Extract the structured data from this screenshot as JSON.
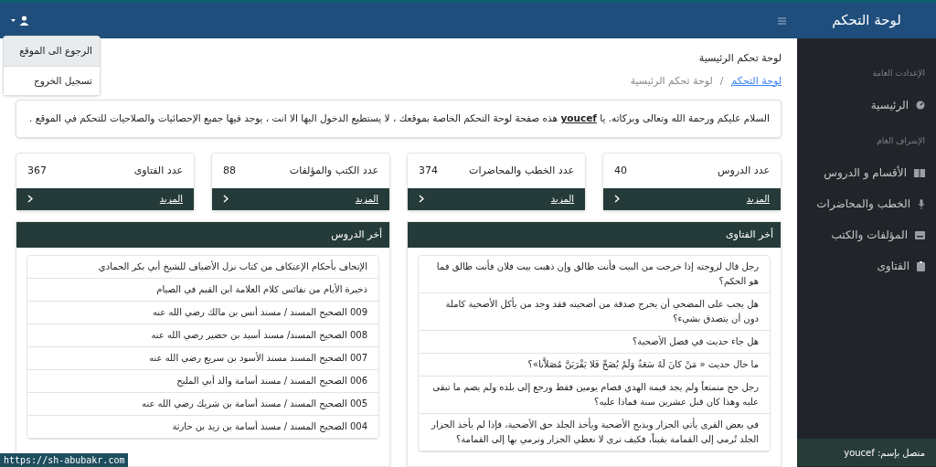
{
  "brand": "لوحة التحكم",
  "user_menu": {
    "items": [
      {
        "label": "الرجوع الى الموقع",
        "selected": true
      },
      {
        "label": "تسجيل الخروج",
        "selected": false
      }
    ]
  },
  "page_title": "لوحة تحكم الرئيسية",
  "breadcrumb": {
    "link": "لوحة التحكم",
    "separator": "/",
    "current": "لوحة تحكم الرئيسية"
  },
  "welcome": {
    "before": "السلام عليكم ورحمة الله وتعالى وبركاته. يا",
    "user": "youcef",
    "after": "هذه صفحة لوحة التحكم الخاصة بموقعك ، لا يستطيع الدخول اليها الا انت ، يوجد فيها جميع الإحصائيات والصلاحيات للتحكم في الموقع ."
  },
  "stats": [
    {
      "label": "عدد الدروس",
      "value": "40",
      "more": "المزيد"
    },
    {
      "label": "عدد الخطب والمحاضرات",
      "value": "374",
      "more": "المزيد"
    },
    {
      "label": "عدد الكتب والمؤلفات",
      "value": "88",
      "more": "المزيد"
    },
    {
      "label": "عدد الفتاوى",
      "value": "367",
      "more": "المزيد"
    }
  ],
  "panels": [
    {
      "title": "أخر الفتاوى",
      "items": [
        "رجل قال لزوجته إذا خرجت من البيت فأنت طالق وإن ذهبت بيت فلان فأنت طالق فما هو الحكم؟",
        "هل يجب على المضحي أن يخرج صدقة من أضحيته فقد وجد من يأكل الأضحية كاملة دون أن يتصدق بشيء؟",
        "هل جاء حديث في فضل الأضحية؟",
        "ما حال حديث « مَنْ كانَ لَهُ سَعَةٌ وَلَمْ يُضَحِّ فَلا يَقْرَبَنَّ مُصَلاَّنا»؟",
        "رجل حج متمتعاً ولم يجد قيمة الهدي فصام يومين فقط ورجع إلى بلده ولم يصم ما تبقى عليه وهذا كان قبل عشرين سنة فماذا عليه؟",
        "في بعض القرى يأتي الجزار ويذبح الأضحية ويأخذ الجلد حق الأضحية، فإذا لم يأخذ الجزار الجلد تُرمى إلى القمامة يقيناً، فكيف ترى لا نعطي الجزار ونرمي بها إلى القمامة؟"
      ]
    },
    {
      "title": "أخر الدروس",
      "items": [
        "الإتحاف بأحكام الإعتكاف من كتاب نزل الأضياف للشيخ أبي بكر الحمادي",
        "ذخيرة الأيام من نفائس كلام العلامة ابن القيم في الصيام",
        "009 الصحيح المسند / مسند أنس بن مالك رضي الله عنه",
        "008 الصحيح المسند/ مسند أسيد بن حضير رضي الله عنه",
        "007 الصحيح المسند مسند الأسود بن سريع رضي الله عنه",
        "006 الصحيح المسند / مسند أسامة والد أبي المليح",
        "005 الصحيح المسند / مسند أسامة بن شريك رضي الله عنه",
        "004 الصحيح المسند / مسند أسامة بن زيد بن حارثة"
      ]
    }
  ],
  "sidebar": {
    "sections": [
      {
        "heading": "الإعدادت العامة",
        "items": [
          {
            "label": "الرئيسية"
          }
        ]
      },
      {
        "heading": "الإشراف العام",
        "items": [
          {
            "label": "الأقسام و الدروس"
          },
          {
            "label": "الخطب والمحاضرات"
          },
          {
            "label": "المؤلفات والكتب"
          },
          {
            "label": "الفتاوى"
          }
        ]
      }
    ],
    "footer": "متصل بإسم: youcef"
  },
  "status_url": "https://sh-abubakr.com"
}
